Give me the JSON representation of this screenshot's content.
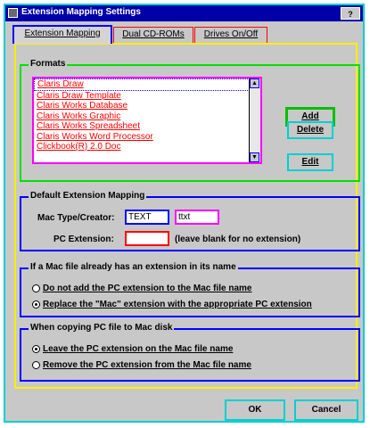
{
  "window": {
    "title": "Extension Mapping Settings",
    "help_label": "?"
  },
  "tabs": [
    {
      "label": "Extension Mapping",
      "active": true
    },
    {
      "label": "Dual CD-ROMs",
      "active": false
    },
    {
      "label": "Drives On/Off",
      "active": false
    }
  ],
  "formats": {
    "legend": "Formats",
    "items": [
      "Claris Draw",
      "Claris Draw Template",
      "Claris Works Database",
      "Claris Works Graphic",
      "Claris Works Spreadsheet",
      "Claris Works Word Processor",
      "Clickbook(R) 2.0 Doc"
    ],
    "add_label": "Add",
    "delete_label": "Delete",
    "edit_label": "Edit"
  },
  "default_mapping": {
    "legend": "Default Extension Mapping",
    "mac_type_label": "Mac Type/Creator:",
    "mac_type_value": "TEXT",
    "mac_creator_value": "ttxt",
    "pc_ext_label": "PC Extension:",
    "pc_ext_value": "",
    "pc_ext_hint": "(leave blank for no extension)"
  },
  "has_extension": {
    "legend": "If a Mac file already has an extension in its name",
    "options": [
      {
        "label": "Do not add the PC extension to the Mac file name",
        "selected": false
      },
      {
        "label": "Replace the \"Mac\" extension with the appropriate PC extension",
        "selected": true
      }
    ]
  },
  "copying": {
    "legend": "When copying PC file to Mac disk",
    "options": [
      {
        "label": "Leave the PC extension on the Mac file name",
        "selected": true
      },
      {
        "label": "Remove the PC extension from the Mac file name",
        "selected": false
      }
    ]
  },
  "footer": {
    "ok_label": "OK",
    "cancel_label": "Cancel"
  }
}
